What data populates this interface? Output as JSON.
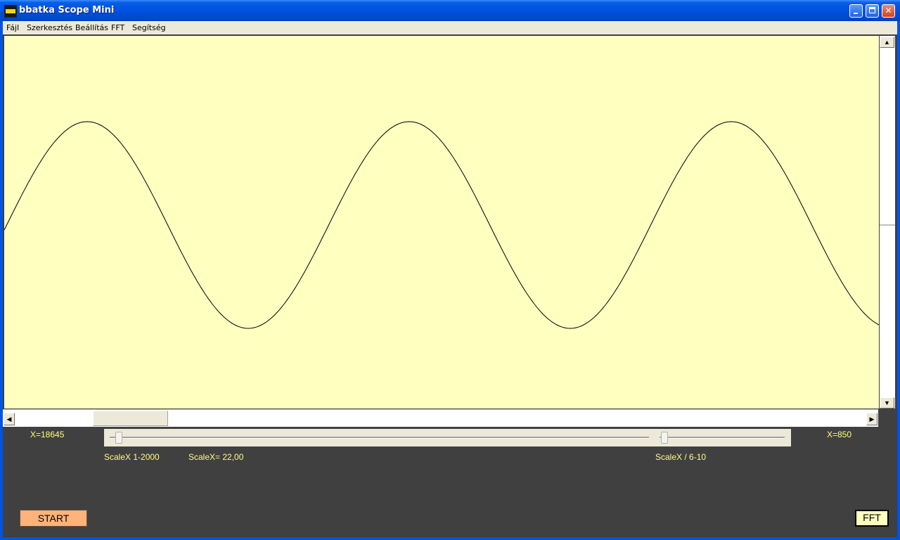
{
  "window": {
    "title": "bbatka Scope Mini"
  },
  "menu": {
    "items": [
      {
        "label": "Fájl"
      },
      {
        "label": "Szerkesztés"
      },
      {
        "label": "Beállítás"
      },
      {
        "label": "FFT"
      },
      {
        "label": "Segítség"
      }
    ]
  },
  "scope": {
    "background_color": "#ffffc0",
    "trace_color": "#000000",
    "waveform": "sine"
  },
  "readouts": {
    "x_left": "X=18645",
    "x_right": "X=850",
    "scalex_range_left": "ScaleX 1-2000",
    "scalex_value": "ScaleX= 22,00",
    "scalex_range_right": "ScaleX / 6-10"
  },
  "controls": {
    "start_label": "START",
    "fft_label": "FFT",
    "start_color": "#ffb37a",
    "label_color": "#ffff80"
  },
  "icons": {
    "minimize": "minimize-icon",
    "maximize": "maximize-icon",
    "close": "close-icon",
    "scroll_up": "arrow-up-icon",
    "scroll_down": "arrow-down-icon",
    "scroll_left": "arrow-left-icon",
    "scroll_right": "arrow-right-icon"
  }
}
